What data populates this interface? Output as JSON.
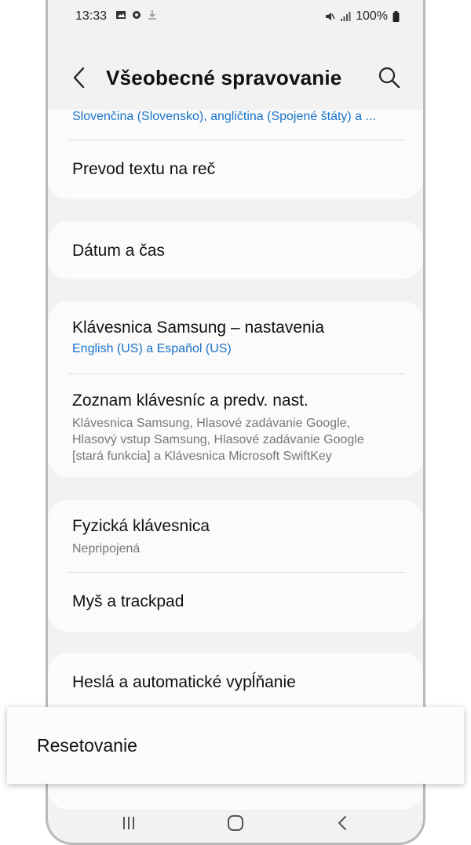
{
  "status_bar": {
    "time": "13:33",
    "battery": "100%",
    "icons": [
      "image-icon",
      "gear-icon",
      "download-icon",
      "mute-icon",
      "signal-icon",
      "battery-icon"
    ]
  },
  "header": {
    "title": "Všeobecné spravovanie",
    "back_icon": "chevron-left-icon",
    "search_icon": "search-icon"
  },
  "sections": {
    "languages_partial": {
      "sub": "Slovenčina (Slovensko), angličtina (Spojené štáty) a ..."
    },
    "tts": {
      "label": "Prevod textu na reč"
    },
    "datetime": {
      "label": "Dátum a čas"
    },
    "samsung_keyboard": {
      "label": "Klávesnica Samsung – nastavenia",
      "sub": "English (US) a Español (US)"
    },
    "keyboard_list": {
      "label": "Zoznam klávesníc a predv. nast.",
      "sub_line1": "Klávesnica Samsung, Hlasové zadávanie Google,",
      "sub_line2": "Hlasový vstup Samsung, Hlasové zadávanie Google",
      "sub_line3": "[stará funkcia] a Klávesnica Microsoft SwiftKey"
    },
    "physical_keyboard": {
      "label": "Fyzická klávesnica",
      "sub": "Nepripojená"
    },
    "mouse": {
      "label": "Myš a trackpad"
    },
    "passwords": {
      "label": "Heslá a automatické vypĺňanie"
    }
  },
  "highlight": {
    "label": "Resetovanie"
  },
  "nav": {
    "recents_icon": "recents-icon",
    "home_icon": "home-icon",
    "back_icon": "back-icon"
  }
}
